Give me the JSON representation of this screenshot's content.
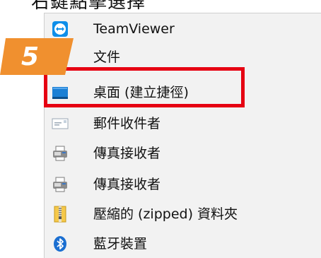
{
  "header": {
    "partial_text": "右鍵點擊選擇"
  },
  "step": {
    "number": "5",
    "color": "#f0902f"
  },
  "highlight_color": "#e60012",
  "menu": {
    "items": [
      {
        "label": "TeamViewer",
        "icon": "teamviewer-icon"
      },
      {
        "label": "文件",
        "icon": "document-icon"
      },
      {
        "label": "桌面 (建立捷徑)",
        "icon": "desktop-icon"
      },
      {
        "label": "郵件收件者",
        "icon": "mail-icon"
      },
      {
        "label": "傳真接收者",
        "icon": "fax-icon"
      },
      {
        "label": "傳真接收者",
        "icon": "fax-icon"
      },
      {
        "label": "壓縮的 (zipped) 資料夾",
        "icon": "zip-folder-icon"
      },
      {
        "label": "藍牙裝置",
        "icon": "bluetooth-icon"
      }
    ]
  }
}
